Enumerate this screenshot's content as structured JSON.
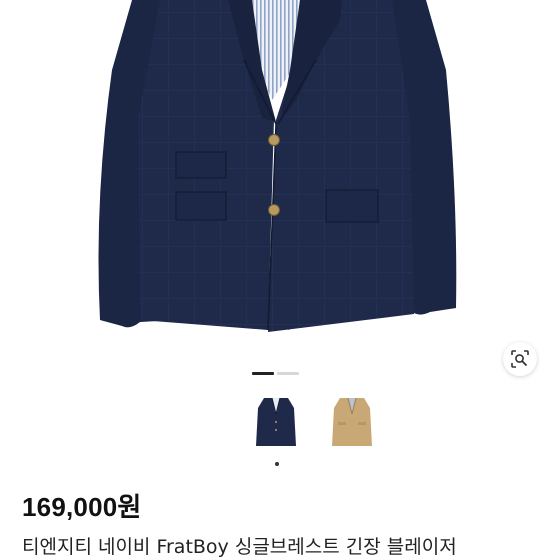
{
  "product": {
    "price": "169,000원",
    "title": "티엔지티 네이비 FratBoy 싱글브레스트 긴장 블레이저"
  },
  "gallery": {
    "image_count": 2,
    "active_index": 0,
    "thumbnails": [
      {
        "color_name": "navy",
        "color": "#1f2a4a",
        "selected": true
      },
      {
        "color_name": "beige",
        "color": "#c8a874",
        "selected": false
      }
    ]
  },
  "colors": {
    "navy": "#1f2a4a",
    "navy_dark": "#161e38",
    "beige": "#c8a874",
    "shirt_stripe": "#8fa3c6",
    "button_gold": "#b69a62"
  },
  "icons": {
    "lens": "image-search-icon"
  }
}
